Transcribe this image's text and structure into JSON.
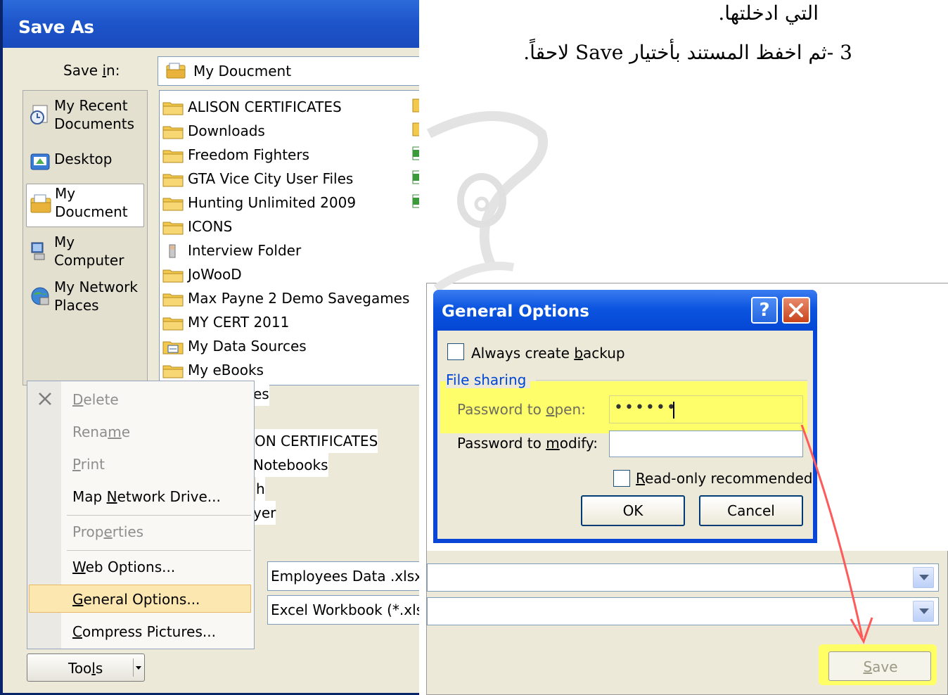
{
  "save_as": {
    "title": "Save As",
    "save_in_label": "Save in:",
    "save_in_value": "My Doucment",
    "places": [
      {
        "label": "My Recent\nDocuments",
        "icon": "recent-documents-icon"
      },
      {
        "label": "Desktop",
        "icon": "desktop-icon"
      },
      {
        "label": "My\nDoucment",
        "icon": "my-documents-icon"
      },
      {
        "label": "My\nComputer",
        "icon": "my-computer-icon"
      },
      {
        "label": "My Network\nPlaces",
        "icon": "network-places-icon"
      }
    ],
    "files": [
      {
        "name": "ALISON CERTIFICATES",
        "icon": "folder-icon"
      },
      {
        "name": "Downloads",
        "icon": "folder-icon"
      },
      {
        "name": "Freedom Fighters",
        "icon": "folder-icon"
      },
      {
        "name": "GTA Vice City User Files",
        "icon": "folder-icon"
      },
      {
        "name": "Hunting Unlimited 2009",
        "icon": "folder-icon"
      },
      {
        "name": "ICONS",
        "icon": "folder-icon"
      },
      {
        "name": "Interview Folder",
        "icon": "interview-folder-icon"
      },
      {
        "name": "JoWooD",
        "icon": "folder-icon"
      },
      {
        "name": "Max Payne 2 Demo Savegames",
        "icon": "folder-icon"
      },
      {
        "name": "MY CERT 2011",
        "icon": "folder-icon"
      },
      {
        "name": "My Data Sources",
        "icon": "data-sources-folder-icon"
      },
      {
        "name": "My eBooks",
        "icon": "folder-icon"
      }
    ],
    "partial_files": [
      "es",
      "ON CERTIFICATES",
      "Notebooks",
      "h",
      "yer"
    ],
    "file_name": "Employees Data .xlsx",
    "file_type": "Excel Workbook (*.xls",
    "tools_label": "Tools",
    "tools_menu": {
      "delete": "Delete",
      "rename": "Rename",
      "print": "Print",
      "map_network_drive": "Map Network Drive...",
      "properties": "Properties",
      "web_options": "Web Options...",
      "general_options": "General Options...",
      "compress_pictures": "Compress Pictures..."
    },
    "save_label": "Save"
  },
  "general_options": {
    "title": "General Options",
    "help_label": "?",
    "always_backup": "Always create backup",
    "file_sharing": "File sharing",
    "password_open_label": "Password to open:",
    "password_open_value": "••••••",
    "password_modify_label": "Password to modify:",
    "read_only": "Read-only recommended",
    "ok": "OK",
    "cancel": "Cancel"
  },
  "instructions": {
    "line1": "التي ادخلتها.",
    "line2": "3 -ثم اخفظ المستند بأختيار Save لاحقاً."
  },
  "colors": {
    "titlebar": "#1d54c9",
    "highlight": "#ffff66",
    "arrow": "#ff5a5a",
    "menu_selected": "#fde7b0"
  }
}
